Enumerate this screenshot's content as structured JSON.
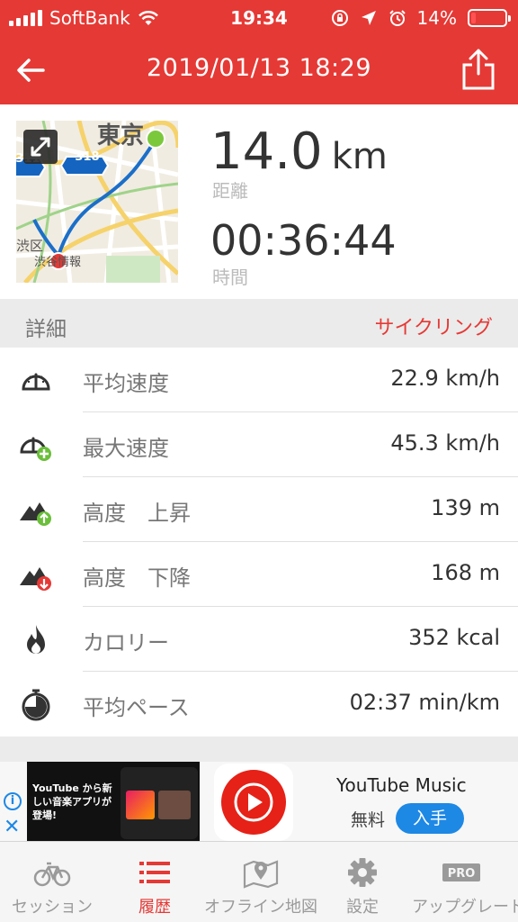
{
  "status_bar": {
    "carrier": "SoftBank",
    "time": "19:34",
    "battery": "14%",
    "battery_level": 0.14
  },
  "nav": {
    "title": "2019/01/13 18:29"
  },
  "summary": {
    "distance_value": "14.0",
    "distance_unit": "km",
    "distance_label": "距離",
    "time_value": "00:36:44",
    "time_label": "時間"
  },
  "map": {
    "route_badge_1": "318",
    "route_badge_2": "311",
    "place_label_1": "東京",
    "place_label_2": "渋区",
    "place_label_3": "渋谷情報"
  },
  "details": {
    "title": "詳細",
    "activity_type": "サイクリング",
    "rows": [
      {
        "label": "平均速度",
        "value": "22.9 km/h",
        "icon": "speedometer-icon"
      },
      {
        "label": "最大速度",
        "value": "45.3 km/h",
        "icon": "max-speed-icon"
      },
      {
        "label": "高度　上昇",
        "value": "139 m",
        "icon": "elevation-up-icon"
      },
      {
        "label": "高度　下降",
        "value": "168 m",
        "icon": "elevation-down-icon"
      },
      {
        "label": "カロリー",
        "value": "352 kcal",
        "icon": "flame-icon"
      },
      {
        "label": "平均ペース",
        "value": "02:37 min/km",
        "icon": "stopwatch-icon"
      }
    ]
  },
  "ad": {
    "phone_text": "YouTube から新しい音楽アプリが登場!",
    "title": "YouTube Music",
    "price": "無料",
    "cta": "入手"
  },
  "tabbar": {
    "tabs": [
      {
        "label": "セッション",
        "icon": "bicycle-icon",
        "active": false
      },
      {
        "label": "履歴",
        "icon": "list-icon",
        "active": true
      },
      {
        "label": "オフライン地図",
        "icon": "map-pin-icon",
        "active": false
      },
      {
        "label": "設定",
        "icon": "gear-icon",
        "active": false
      },
      {
        "label": "アップグレード",
        "icon": "pro-icon",
        "active": false
      }
    ]
  },
  "colors": {
    "brand": "#e53935",
    "ad_blue": "#1e88e5",
    "green": "#6abf3a"
  }
}
